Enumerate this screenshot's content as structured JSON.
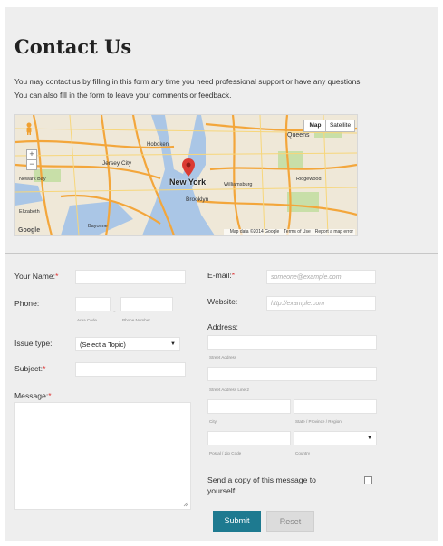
{
  "page": {
    "title": "Contact Us",
    "intro_line1": "You may contact us by filling in this form any time you need professional support or have any questions.",
    "intro_line2": "You can also fill in the form to leave your comments or feedback."
  },
  "map": {
    "place_label": "New York",
    "map_button": "Map",
    "satellite_button": "Satellite",
    "zoom_in": "+",
    "zoom_out": "−",
    "labels": [
      "Queens",
      "Jersey City",
      "Hoboken",
      "Brooklyn",
      "Williamsburg",
      "Ridgewood",
      "Bayonne",
      "Newark Bay",
      "Elizabeth"
    ],
    "footer": [
      "Map data ©2014 Google",
      "Terms of Use",
      "Report a map error"
    ],
    "logo": "Google",
    "pin_color": "#db3b33"
  },
  "form": {
    "name_label": "Your Name:",
    "email_label": "E-mail:",
    "email_placeholder": "someone@example.com",
    "phone_label": "Phone:",
    "phone_separator": "-",
    "area_code_caption": "Area Code",
    "phone_number_caption": "Phone Number",
    "website_label": "Website:",
    "website_placeholder": "http://example.com",
    "address_label": "Address:",
    "street_caption": "Street Address",
    "street2_caption": "Street Address Line 2",
    "city_caption": "City",
    "state_caption": "State / Province / Region",
    "postal_caption": "Postal / Zip Code",
    "country_caption": "Country",
    "issue_label": "Issue type:",
    "issue_selected": "(Select a Topic)",
    "subject_label": "Subject:",
    "message_label": "Message:",
    "copy_label_line1": "Send a copy of this message to",
    "copy_label_line2": "yourself:",
    "required_mark": "*",
    "submit_label": "Submit",
    "reset_label": "Reset"
  },
  "colors": {
    "accent": "#1e7a90",
    "required": "#dd3333",
    "background": "#eeeeee"
  }
}
